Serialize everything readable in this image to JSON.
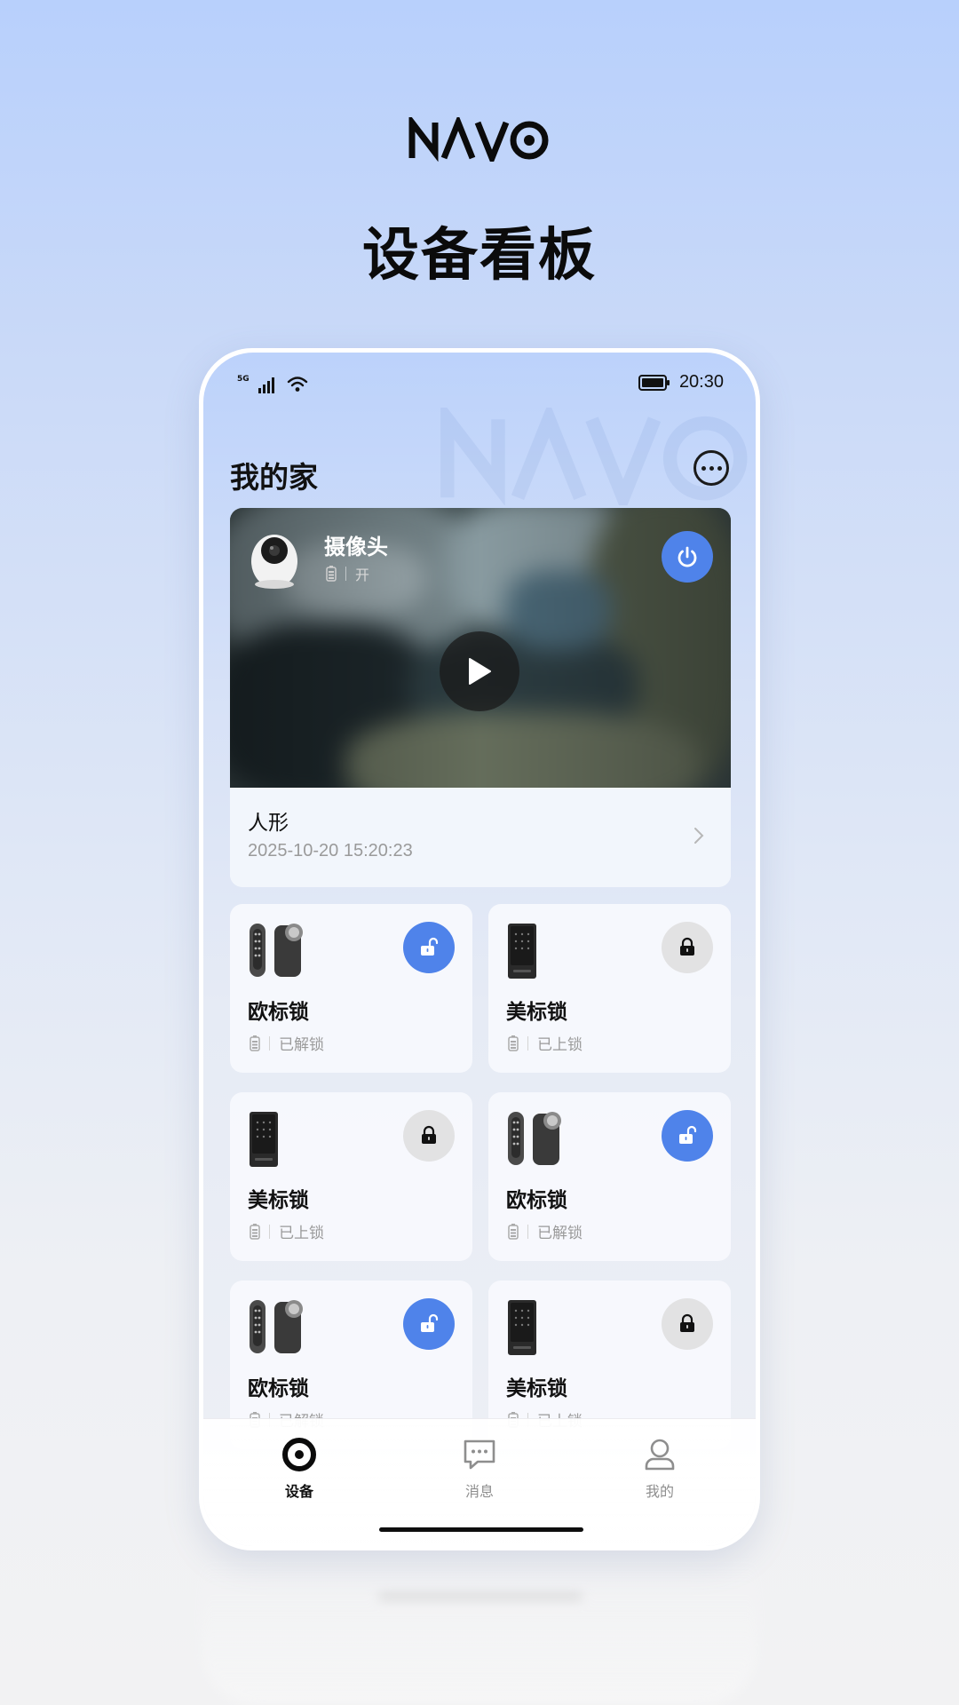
{
  "promo": {
    "brand": "NAVO",
    "title": "设备看板"
  },
  "status_bar": {
    "network": "5G",
    "time": "20:30"
  },
  "header": {
    "title": "我的家",
    "more_icon": "more-dots-icon"
  },
  "camera": {
    "name": "摄像头",
    "status": "开",
    "event_label": "人形",
    "event_time": "2025-10-20 15:20:23"
  },
  "devices": [
    {
      "name": "欧标锁",
      "status": "已解锁",
      "state": "unlocked"
    },
    {
      "name": "美标锁",
      "status": "已上锁",
      "state": "locked"
    },
    {
      "name": "美标锁",
      "status": "已上锁",
      "state": "locked"
    },
    {
      "name": "欧标锁",
      "status": "已解锁",
      "state": "unlocked"
    },
    {
      "name": "欧标锁",
      "status": "已解锁",
      "state": "unlocked"
    },
    {
      "name": "美标锁",
      "status": "已上锁",
      "state": "locked"
    }
  ],
  "tabs": [
    {
      "label": "设备",
      "icon": "device-eye-icon",
      "active": true
    },
    {
      "label": "消息",
      "icon": "message-bubble-icon",
      "active": false
    },
    {
      "label": "我的",
      "icon": "person-icon",
      "active": false
    }
  ],
  "colors": {
    "accent": "#4f83ea",
    "locked_bg": "#e2e2e3"
  }
}
